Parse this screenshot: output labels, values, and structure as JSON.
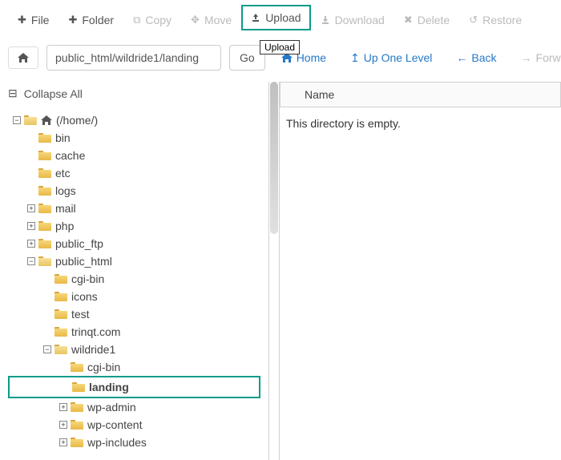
{
  "toolbar": {
    "file": "File",
    "folder": "Folder",
    "copy": "Copy",
    "move": "Move",
    "upload": "Upload",
    "download": "Download",
    "delete": "Delete",
    "restore": "Restore",
    "tooltip": "Upload"
  },
  "nav": {
    "path": "public_html/wildride1/landing",
    "go": "Go",
    "home": "Home",
    "up": "Up One Level",
    "back": "Back",
    "forward": "Forward"
  },
  "side": {
    "collapse": "Collapse All",
    "root": "(/home/)"
  },
  "tree": {
    "bin": "bin",
    "cache": "cache",
    "etc": "etc",
    "logs": "logs",
    "mail": "mail",
    "php": "php",
    "public_ftp": "public_ftp",
    "public_html": "public_html",
    "cgi_bin": "cgi-bin",
    "icons": "icons",
    "test": "test",
    "trinqt": "trinqt.com",
    "wildride1": "wildride1",
    "cgi_bin2": "cgi-bin",
    "landing": "landing",
    "wp_admin": "wp-admin",
    "wp_content": "wp-content",
    "wp_includes": "wp-includes"
  },
  "content": {
    "header": "Name",
    "empty": "This directory is empty."
  }
}
